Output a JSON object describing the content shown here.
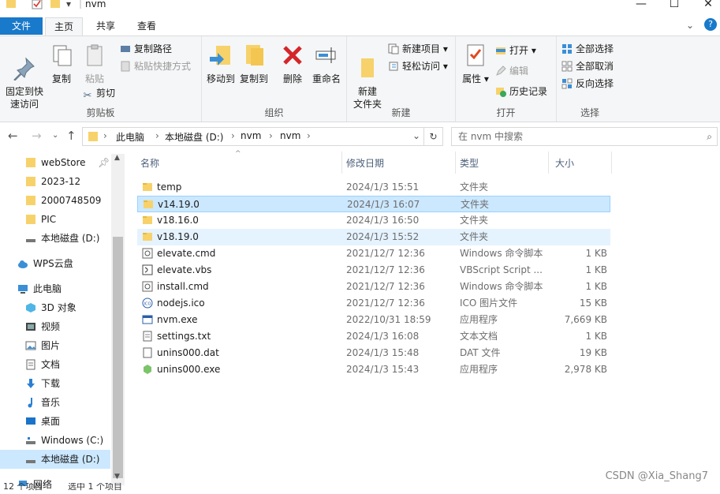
{
  "title": "nvm",
  "tabs": [
    "文件",
    "主页",
    "共享",
    "查看"
  ],
  "ribbon": {
    "clipboard": {
      "pin": "固定到快\n速访问",
      "copy": "复制",
      "paste": "粘贴",
      "copy_path": "复制路径",
      "paste_shortcut": "粘贴快捷方式",
      "cut": "剪切",
      "label": "剪贴板"
    },
    "organize": {
      "move_to": "移动到",
      "copy_to": "复制到",
      "delete": "删除",
      "rename": "重命名",
      "label": "组织"
    },
    "new": {
      "new_folder": "新建\n文件夹",
      "new_item": "新建项目",
      "easy_access": "轻松访问",
      "label": "新建"
    },
    "open": {
      "properties": "属性",
      "open": "打开",
      "edit": "编辑",
      "history": "历史记录",
      "label": "打开"
    },
    "select": {
      "select_all": "全部选择",
      "select_none": "全部取消",
      "invert": "反向选择",
      "label": "选择"
    }
  },
  "address": {
    "crumbs": [
      "此电脑",
      "本地磁盘 (D:)",
      "nvm",
      "nvm"
    ],
    "search_placeholder": "在 nvm 中搜索"
  },
  "nav": [
    {
      "label": "webStore",
      "icon": "folder-icon"
    },
    {
      "label": "2023-12",
      "icon": "folder-icon"
    },
    {
      "label": "2000748509",
      "icon": "folder-icon"
    },
    {
      "label": "PIC",
      "icon": "folder-icon"
    },
    {
      "label": "本地磁盘 (D:)",
      "icon": "drive-icon"
    },
    {
      "label": "WPS云盘",
      "icon": "cloud-icon"
    },
    {
      "label": "此电脑",
      "icon": "computer-icon"
    },
    {
      "label": "3D 对象",
      "icon": "3d-icon"
    },
    {
      "label": "视频",
      "icon": "video-icon"
    },
    {
      "label": "图片",
      "icon": "pictures-icon"
    },
    {
      "label": "文档",
      "icon": "documents-icon"
    },
    {
      "label": "下载",
      "icon": "download-icon"
    },
    {
      "label": "音乐",
      "icon": "music-icon"
    },
    {
      "label": "桌面",
      "icon": "desktop-icon"
    },
    {
      "label": "Windows (C:)",
      "icon": "drive-icon"
    },
    {
      "label": "本地磁盘 (D:)",
      "icon": "drive-icon"
    },
    {
      "label": "网络",
      "icon": "network-icon"
    }
  ],
  "columns": {
    "name": "名称",
    "date": "修改日期",
    "type": "类型",
    "size": "大小"
  },
  "files": [
    {
      "name": "temp",
      "date": "2024/1/3 15:51",
      "type": "文件夹",
      "size": "",
      "icon": "folder-icon"
    },
    {
      "name": "v14.19.0",
      "date": "2024/1/3 16:07",
      "type": "文件夹",
      "size": "",
      "icon": "folder-icon"
    },
    {
      "name": "v18.16.0",
      "date": "2024/1/3 16:50",
      "type": "文件夹",
      "size": "",
      "icon": "folder-icon"
    },
    {
      "name": "v18.19.0",
      "date": "2024/1/3 15:52",
      "type": "文件夹",
      "size": "",
      "icon": "folder-icon"
    },
    {
      "name": "elevate.cmd",
      "date": "2021/12/7 12:36",
      "type": "Windows 命令脚本",
      "size": "1 KB",
      "icon": "cmd-icon"
    },
    {
      "name": "elevate.vbs",
      "date": "2021/12/7 12:36",
      "type": "VBScript Script ...",
      "size": "1 KB",
      "icon": "vbs-icon"
    },
    {
      "name": "install.cmd",
      "date": "2021/12/7 12:36",
      "type": "Windows 命令脚本",
      "size": "1 KB",
      "icon": "cmd-icon"
    },
    {
      "name": "nodejs.ico",
      "date": "2021/12/7 12:36",
      "type": "ICO 图片文件",
      "size": "15 KB",
      "icon": "ico-icon"
    },
    {
      "name": "nvm.exe",
      "date": "2022/10/31 18:59",
      "type": "应用程序",
      "size": "7,669 KB",
      "icon": "exe-icon"
    },
    {
      "name": "settings.txt",
      "date": "2024/1/3 16:08",
      "type": "文本文档",
      "size": "1 KB",
      "icon": "txt-icon"
    },
    {
      "name": "unins000.dat",
      "date": "2024/1/3 15:48",
      "type": "DAT 文件",
      "size": "19 KB",
      "icon": "dat-icon"
    },
    {
      "name": "unins000.exe",
      "date": "2024/1/3 15:43",
      "type": "应用程序",
      "size": "2,978 KB",
      "icon": "installer-icon"
    }
  ],
  "status": {
    "count": "12 个项目",
    "selected": "选中 1 个项目"
  },
  "watermark": "CSDN @Xia_Shang7"
}
